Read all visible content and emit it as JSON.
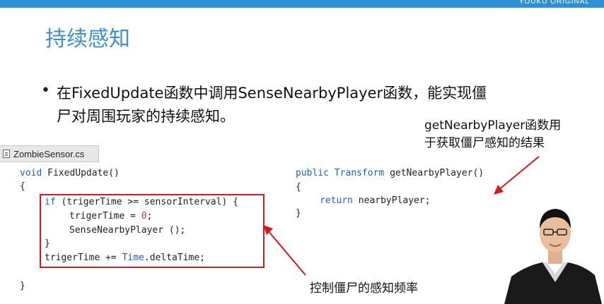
{
  "header": {
    "top_bar_text": "YOUKU ORIGINAL",
    "accent_color": "#2e8fd3"
  },
  "slide": {
    "title": "持续感知",
    "bullet_line_1": "在FixedUpdate函数中调用SenseNearbyPlayer函数，能实现僵",
    "bullet_line_2": "尸对周围玩家的持续感知。",
    "annotation_right_1": "getNearbyPlayer函数用",
    "annotation_right_2": "于获取僵尸感知的结果",
    "annotation_bottom": "控制僵尸的感知频率"
  },
  "editor": {
    "tab_name": "ZombieSensor.cs",
    "left_code": {
      "line1_kw": "void",
      "line1_rest": " FixedUpdate()",
      "line2": "{",
      "line3_kw": "if",
      "line3_rest": " (trigerTime >= sensorInterval) {",
      "line4_a": "trigerTime = ",
      "line4_num": "0",
      "line4_b": ";",
      "line5": "SenseNearbyPlayer ();",
      "line6": "}",
      "line7_a": "trigerTime += ",
      "line7_kw": "Time",
      "line7_b": ".deltaTime;",
      "line8": "}"
    },
    "right_code": {
      "line1_kw1": "public",
      "line1_kw2": "Transform",
      "line1_rest": " getNearbyPlayer()",
      "line2": "{",
      "line3_kw": "return",
      "line3_rest": " nearbyPlayer;",
      "line4": "}"
    }
  },
  "colors": {
    "title": "#3b8fd0",
    "keyword": "#1f5fc4",
    "highlight_box": "#d6181f"
  }
}
